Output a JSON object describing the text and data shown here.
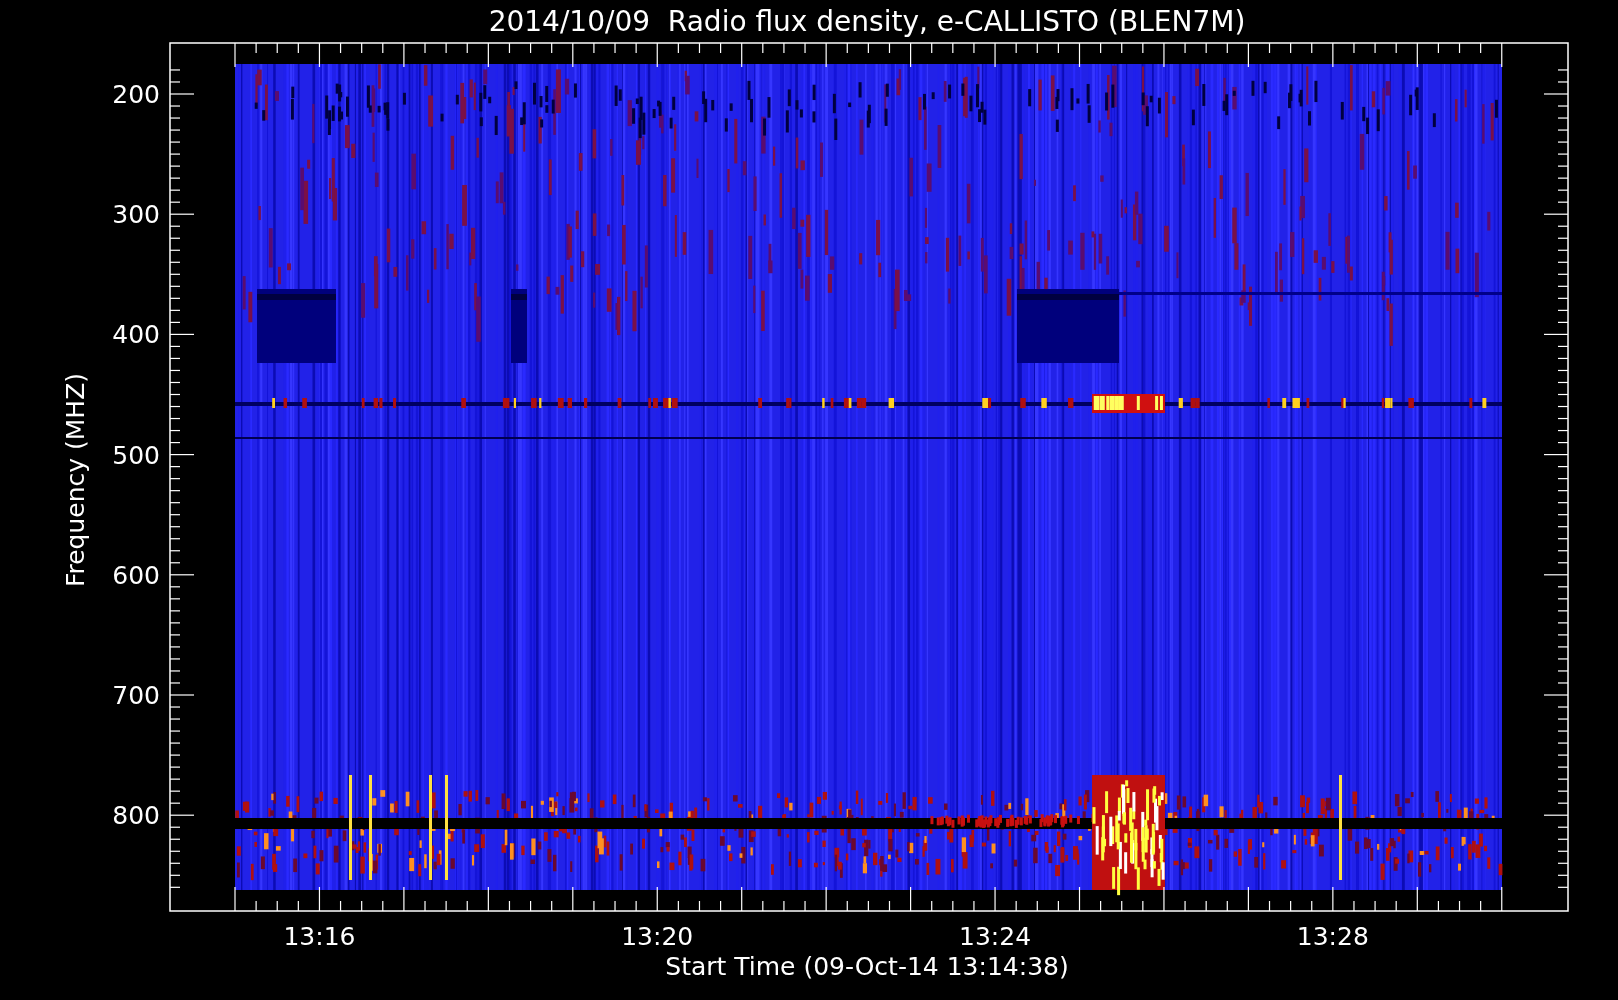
{
  "title": "2014/10/09  Radio flux density, e-CALLISTO (BLEN7M)",
  "y_axis": {
    "label": "Frequency (MHZ)",
    "ticks": [
      "200",
      "300",
      "400",
      "500",
      "600",
      "700",
      "800"
    ]
  },
  "x_axis": {
    "label": "Start Time (09-Oct-14 13:14:38)",
    "ticks": [
      "13:16",
      "13:20",
      "13:24",
      "13:28"
    ]
  }
}
